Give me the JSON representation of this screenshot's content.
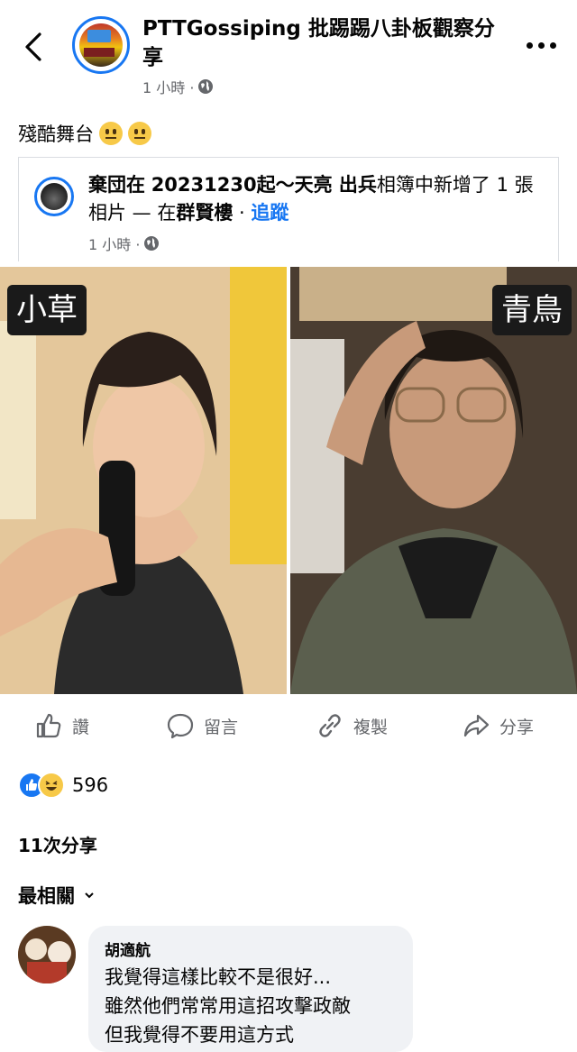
{
  "header": {
    "page_name": "PTTGossiping 批踢踢八卦板觀察分享",
    "time": "1 小時 ·",
    "icons": {
      "back": "chevron-left-icon",
      "privacy": "globe-icon",
      "more": "more-icon"
    }
  },
  "post": {
    "caption": "殘酷舞台",
    "caption_emojis": [
      "neutral-face-emoji",
      "neutral-face-emoji"
    ]
  },
  "shared": {
    "actor": "棄団在",
    "album": "20231230起～天亮 出兵",
    "middle": "相簿中新增了 1 張相片 — 在",
    "place": "群賢樓",
    "separator": " · ",
    "follow": "追蹤",
    "time": "1 小時 ·"
  },
  "photo": {
    "left_label": "小草",
    "right_label": "青鳥"
  },
  "actions": {
    "like": "讚",
    "comment": "留言",
    "copy": "複製",
    "share": "分享"
  },
  "stats": {
    "reaction_count": "596",
    "reaction_icons": [
      "like-icon",
      "haha-icon"
    ],
    "share_count": "11次分享"
  },
  "comments": {
    "sort_label": "最相關",
    "items": [
      {
        "author": "胡適航",
        "lines": [
          "我覺得這樣比較不是很好...",
          "雖然他們常常用這招攻擊政敵",
          "但我覺得不要用這方式"
        ]
      }
    ]
  },
  "colors": {
    "accent": "#1877f2",
    "muted": "#65676b",
    "text": "#050505",
    "bubble": "#f0f2f5"
  }
}
